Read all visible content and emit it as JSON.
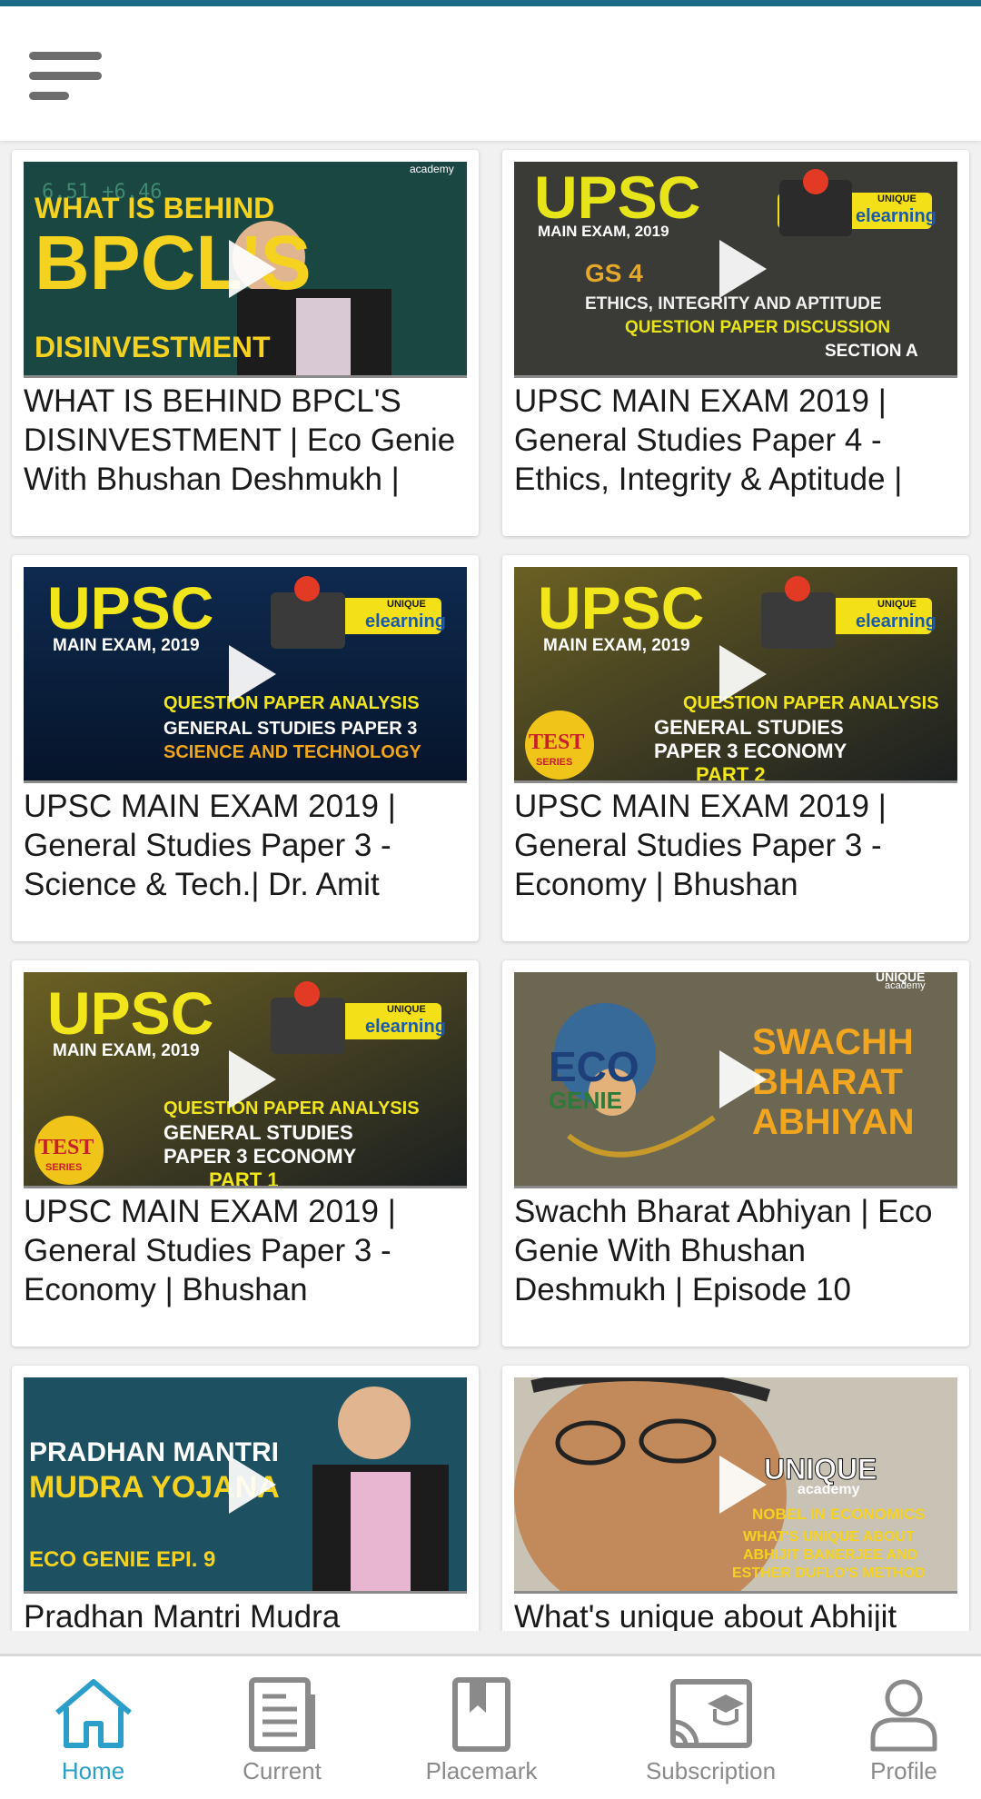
{
  "colors": {
    "accent": "#2b9fc9",
    "top_bar": "#1b6b86",
    "nav_inactive": "#8a8a8a"
  },
  "header": {
    "menu_icon": "hamburger-menu-icon"
  },
  "videos": [
    {
      "title": "WHAT IS BEHIND BPCL'S DISINVESTMENT | Eco Genie With Bhushan Deshmukh |",
      "thumb": {
        "l1": "WHAT IS BEHIND",
        "l2": "BPCL'S",
        "l3": "DISINVESTMENT",
        "brand": "academy"
      }
    },
    {
      "title": "UPSC MAIN EXAM 2019 | General Studies Paper 4 - Ethics, Integrity & Aptitude |",
      "thumb": {
        "l1": "UPSC",
        "l2": "MAIN EXAM, 2019",
        "l3": "GS 4",
        "l4": "ETHICS, INTEGRITY AND APTITUDE",
        "l5": "QUESTION PAPER DISCUSSION",
        "l6": "SECTION A",
        "brand": "elearning",
        "brand_small": "UNIQUE"
      }
    },
    {
      "title": "UPSC MAIN EXAM 2019 | General Studies Paper 3 - Science & Tech.| Dr. Amit",
      "thumb": {
        "l1": "UPSC",
        "l2": "MAIN EXAM, 2019",
        "l3": "QUESTION PAPER ANALYSIS",
        "l4": "GENERAL STUDIES PAPER 3",
        "l5": "SCIENCE AND TECHNOLOGY",
        "brand": "elearning",
        "brand_small": "UNIQUE"
      }
    },
    {
      "title": "UPSC MAIN EXAM 2019 | General Studies Paper 3 - Economy | Bhushan",
      "thumb": {
        "l1": "UPSC",
        "l2": "MAIN EXAM, 2019",
        "l3": "QUESTION PAPER ANALYSIS",
        "l4": "GENERAL STUDIES",
        "l5": "PAPER 3 ECONOMY",
        "l6": "PART 2",
        "badge": "TEST",
        "badge2": "SERIES",
        "brand": "elearning",
        "brand_small": "UNIQUE"
      }
    },
    {
      "title": "UPSC MAIN EXAM 2019 | General Studies Paper 3 -Economy | Bhushan",
      "thumb": {
        "l1": "UPSC",
        "l2": "MAIN EXAM, 2019",
        "l3": "QUESTION PAPER ANALYSIS",
        "l4": "GENERAL STUDIES",
        "l5": "PAPER 3 ECONOMY",
        "l6": "PART 1",
        "badge": "TEST",
        "badge2": "SERIES",
        "brand": "elearning",
        "brand_small": "UNIQUE"
      }
    },
    {
      "title": "Swachh Bharat Abhiyan | Eco Genie With Bhushan Deshmukh | Episode 10",
      "thumb": {
        "l1": "SWACHH",
        "l2": "BHARAT",
        "l3": "ABHIYAN",
        "l4": "ECO",
        "l5": "GENIE",
        "brand": "UNIQUE",
        "brand_small": "academy"
      }
    },
    {
      "title": "Pradhan Mantri Mudra",
      "thumb": {
        "l1": "PRADHAN MANTRI",
        "l2": "MUDRA YOJANA",
        "l3": "ECO GENIE EPI. 9"
      }
    },
    {
      "title": "What's unique about Abhijit",
      "thumb": {
        "l1": "UNIQUE",
        "l2": "academy",
        "l3": "NOBEL IN ECONOMICS",
        "l4": "WHAT'S UNIQUE ABOUT",
        "l5": "ABHIJIT BANERJEE AND",
        "l6": "ESTHER DUFLO'S METHOD"
      }
    }
  ],
  "bottom_nav": [
    {
      "label": "Home",
      "icon": "home-icon",
      "active": true
    },
    {
      "label": "Current",
      "icon": "document-icon",
      "active": false
    },
    {
      "label": "Placemark",
      "icon": "bookmark-icon",
      "active": false
    },
    {
      "label": "Subscription",
      "icon": "cast-education-icon",
      "active": false
    },
    {
      "label": "Profile",
      "icon": "person-icon",
      "active": false
    }
  ]
}
